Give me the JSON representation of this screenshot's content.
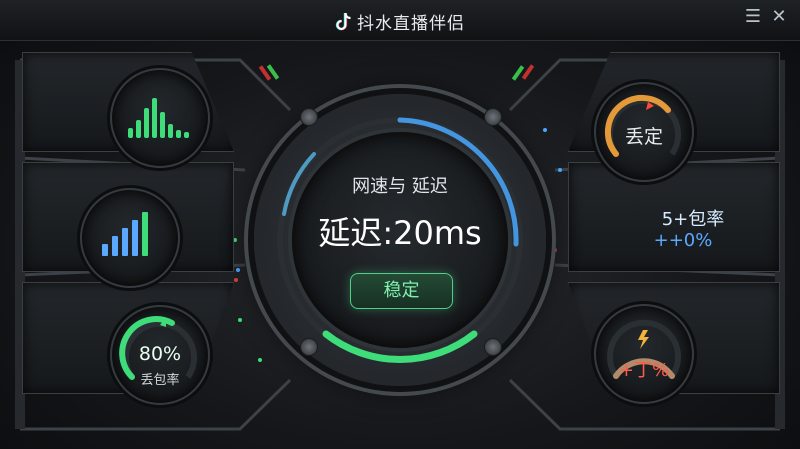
{
  "app": {
    "title": "抖水直播伴侣"
  },
  "window_controls": {
    "minimize": "☰",
    "close": "✕"
  },
  "center": {
    "heading": "网速与 延迟",
    "latency": "延迟:20ms",
    "status_button": "稳定"
  },
  "right": {
    "top_label": "丢定",
    "middle_line1": "5+包率",
    "middle_line2": "++0%",
    "bottom_value": "+丁%"
  },
  "left": {
    "bottom_value": "80%",
    "bottom_label": "丢包率"
  },
  "colors": {
    "accent_green": "#3fdc7a",
    "accent_blue": "#4aa8ff",
    "gauge_orange": "#e59a3a",
    "gauge_red": "#ff4a3a"
  }
}
